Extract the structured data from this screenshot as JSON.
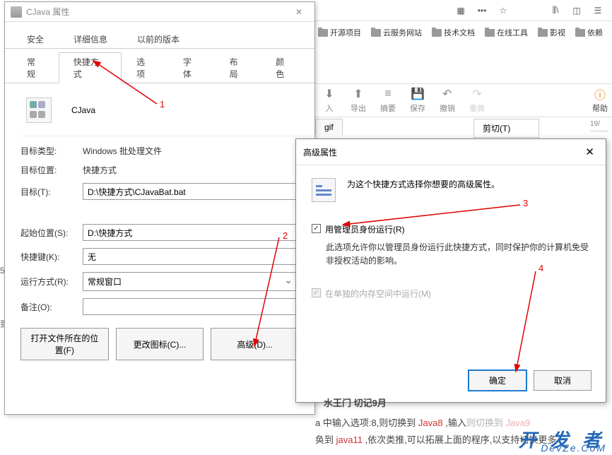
{
  "browser": {
    "icons": [
      "grid",
      "more",
      "star",
      "library",
      "sidebar",
      "reader"
    ]
  },
  "bookmarks": [
    "开源项目",
    "云服务网站",
    "技术文档",
    "在线工具",
    "影视",
    "依赖"
  ],
  "propsDialog": {
    "title": "CJava 属性",
    "tabsTop": [
      "安全",
      "详细信息",
      "以前的版本"
    ],
    "tabsBottom": [
      "常规",
      "快捷方式",
      "选项",
      "字体",
      "布局",
      "颜色"
    ],
    "activeTab": "快捷方式",
    "appName": "CJava",
    "rows": {
      "targetTypeLabel": "目标类型:",
      "targetTypeValue": "Windows 批处理文件",
      "targetLocLabel": "目标位置:",
      "targetLocValue": "快捷方式",
      "targetLabel": "目标(T):",
      "targetValue": "D:\\快捷方式\\CJavaBat.bat",
      "startInLabel": "起始位置(S):",
      "startInValue": "D:\\快捷方式",
      "shortcutKeyLabel": "快捷键(K):",
      "shortcutKeyValue": "无",
      "runLabel": "运行方式(R):",
      "runValue": "常规窗口",
      "commentLabel": "备注(O):",
      "commentValue": ""
    },
    "buttons": {
      "openLoc": "打开文件所在的位置(F)",
      "changeIcon": "更改图标(C)...",
      "advanced": "高级(D)..."
    }
  },
  "advDialog": {
    "title": "高级属性",
    "desc": "为这个快捷方式选择你想要的高级属性。",
    "runAsAdmin": "用管理员身份运行(R)",
    "runAsAdminDesc": "此选项允许你以管理员身份运行此快捷方式，同时保护你的计算机免受非授权活动的影响。",
    "separateMem": "在单独的内存空间中运行(M)",
    "ok": "确定",
    "cancel": "取消"
  },
  "bgToolbar": {
    "items": [
      "入",
      "导出",
      "摘要",
      "保存",
      "撤销",
      "重做"
    ],
    "help": "帮助"
  },
  "bgTabs": {
    "gif": "gif",
    "cut": "剪切(T)",
    "date": "19/"
  },
  "annotations": {
    "n1": "1",
    "n2": "2",
    "n3": "3",
    "n4": "4"
  },
  "article": {
    "line0": "水王门 切记9月",
    "line1a": "a 中输入选项:8,则切换到 ",
    "java8": "Java8",
    "line1b": " ,输入",
    "line1c": "则切换到",
    "java9": "Java9",
    "line2a": "奂到 ",
    "java11": "java11",
    "line2b": " ,依次类推,可以拓展上面的程序,以支持切换更多"
  },
  "watermark": {
    "main": "开 发 者",
    "sub": "DevZe.CoM"
  },
  "leftEdge": [
    "5",
    "到"
  ]
}
